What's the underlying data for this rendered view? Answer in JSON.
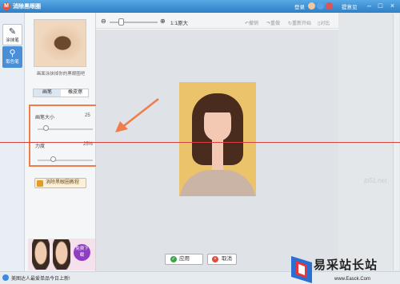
{
  "window": {
    "title": "消除黑眼圈",
    "login": "登录",
    "feedback": "提意见",
    "controls": [
      "–",
      "□",
      "×"
    ]
  },
  "tools": [
    {
      "label": "涂抹笔",
      "icon": "brush-icon",
      "active": true
    },
    {
      "label": "取色笔",
      "icon": "dropper-icon",
      "active": false
    }
  ],
  "panel": {
    "caption": "画面涂抹掉你的黑眼圈吧",
    "tabs": [
      "画笔",
      "橡皮擦"
    ],
    "brush_size": {
      "label": "画笔大小",
      "value": "25",
      "level": 0.12
    },
    "strength": {
      "label": "力度",
      "value": "25%",
      "level": 0.25
    },
    "tutorial": "消除黑眼圈教程",
    "ad_badge": "免费下载"
  },
  "toolbar": {
    "zoom_level": 0.2,
    "original_size": "1:1原大",
    "undo": "撤销",
    "redo": "重做",
    "reset": "重新开始",
    "compare": "对比"
  },
  "actions": {
    "apply": "应用",
    "cancel": "取消"
  },
  "status": {
    "text": "美图达人最爱单品今日上新!"
  },
  "watermark": {
    "corner_text": "jb51.net",
    "site_name": "易采站长站",
    "url": "www.Easck.Com"
  },
  "colors": {
    "accent": "#2e7fc6",
    "highlight_box": "#f07c49",
    "guide_line": "#d84040"
  }
}
